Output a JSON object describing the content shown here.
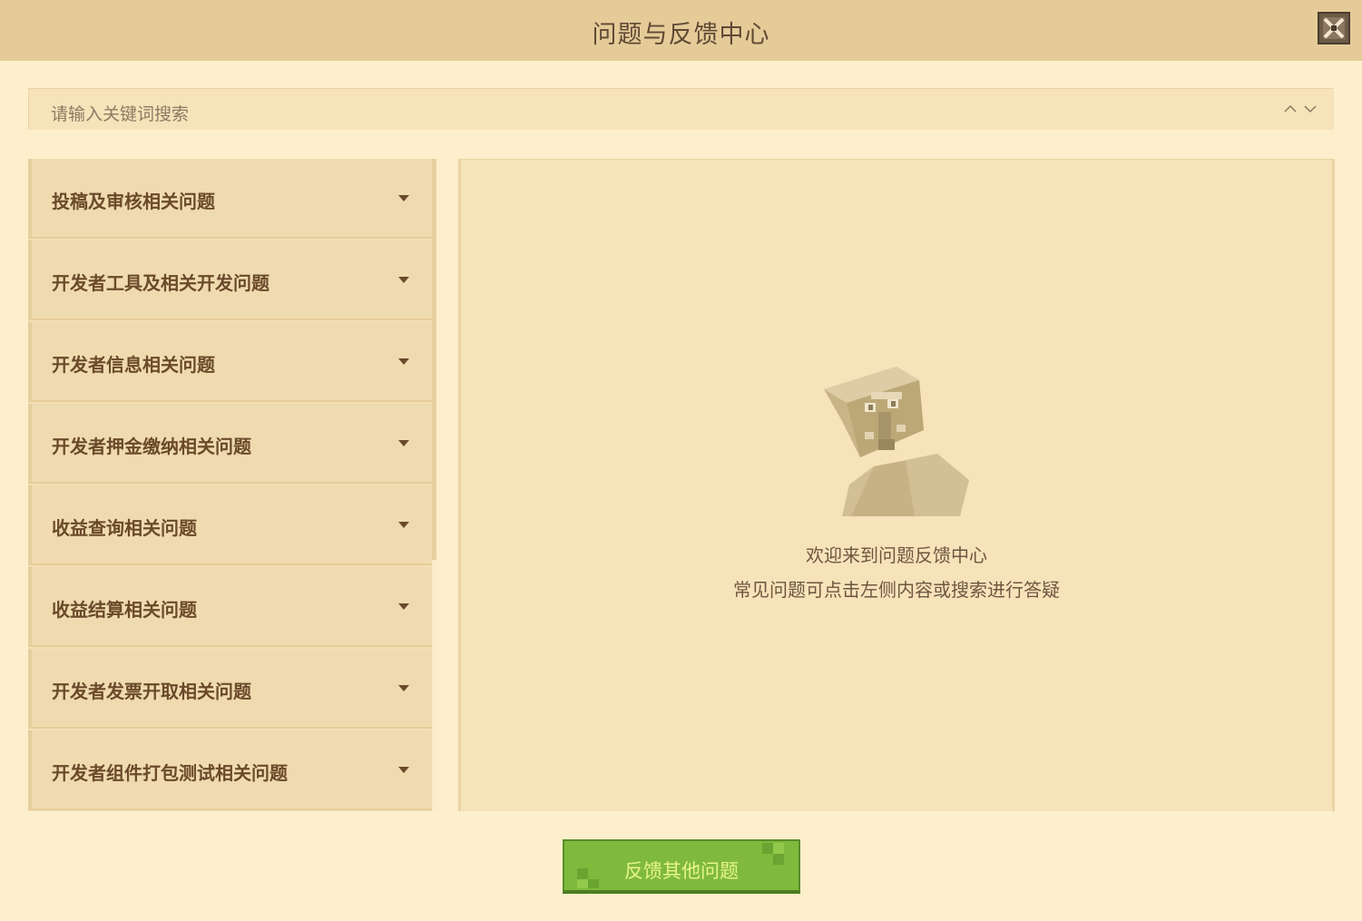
{
  "window": {
    "title": "问题与反馈中心"
  },
  "search": {
    "placeholder": "请输入关键词搜索"
  },
  "categories": [
    {
      "label": "投稿及审核相关问题"
    },
    {
      "label": "开发者工具及相关开发问题"
    },
    {
      "label": "开发者信息相关问题"
    },
    {
      "label": "开发者押金缴纳相关问题"
    },
    {
      "label": "收益查询相关问题"
    },
    {
      "label": "收益结算相关问题"
    },
    {
      "label": "开发者发票开取相关问题"
    },
    {
      "label": "开发者组件打包测试相关问题"
    }
  ],
  "panel": {
    "welcome": "欢迎来到问题反馈中心",
    "hint": "常见问题可点击左侧内容或搜索进行答疑"
  },
  "footer": {
    "feedback_label": "反馈其他问题"
  },
  "colors": {
    "title_bar": "#e5cb98",
    "background": "#fdefcc",
    "accent_green": "#7fba3c"
  }
}
